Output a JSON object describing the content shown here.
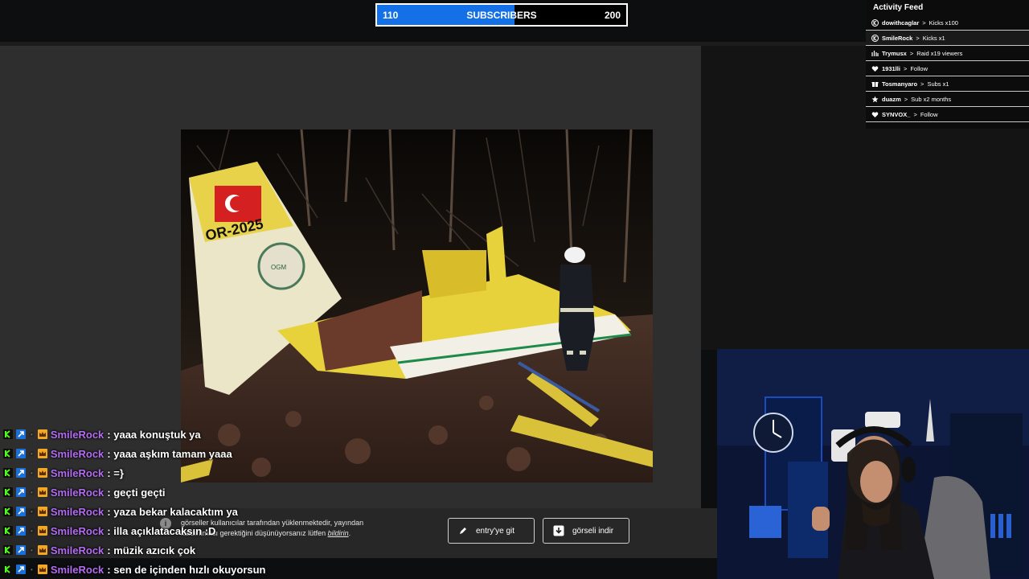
{
  "goal": {
    "current": "110",
    "label": "SUBSCRIBERS",
    "target": "200",
    "progress": 0.55,
    "fill_color": "#1470e6"
  },
  "activity_feed": {
    "title": "Activity Feed",
    "items": [
      {
        "user": "dowithcaglar",
        "action": "Kicks x100",
        "icon": "kick-icon"
      },
      {
        "user": "SmileRock",
        "action": "Kicks x1",
        "icon": "kick-icon"
      },
      {
        "user": "Trymusx",
        "action": "Raid x19 viewers",
        "icon": "raid-icon"
      },
      {
        "user": "1931lli",
        "action": "Follow",
        "icon": "heart-icon"
      },
      {
        "user": "Tosmanyaro",
        "action": "Subs x1",
        "icon": "gift-icon"
      },
      {
        "user": "duazm",
        "action": "Sub x2 months",
        "icon": "star-icon"
      },
      {
        "user": "SYNVOX_",
        "action": "Follow",
        "icon": "heart-icon"
      }
    ],
    "separator": ">"
  },
  "viewer": {
    "notice_text": "görseller kullanıcılar tarafından yüklenmektedir, yayından kaldırılması gerektiğini düşünüyorsanız lütfen",
    "notice_link": "bildirin",
    "entry_button": "entry'ye git",
    "download_button": "görseli indir",
    "plane_tail_text": "OR-2025",
    "plane_logo_text": "OGM"
  },
  "chat": {
    "messages": [
      {
        "user": "SmileRock",
        "text": ": yaaa konuştuk ya"
      },
      {
        "user": "SmileRock",
        "text": ": yaaa aşkım tamam yaaa"
      },
      {
        "user": "SmileRock",
        "text": ": =}"
      },
      {
        "user": "SmileRock",
        "text": ": geçti geçti"
      },
      {
        "user": "SmileRock",
        "text": ": yaza bekar kalacaktım ya"
      },
      {
        "user": "SmileRock",
        "text": ": illa açıklatacaksın :D"
      },
      {
        "user": "SmileRock",
        "text": ": müzik azıcık çok"
      },
      {
        "user": "SmileRock",
        "text": ": sen de içinden hızlı okuyorsun"
      }
    ],
    "username_color": "#b46cf2"
  }
}
